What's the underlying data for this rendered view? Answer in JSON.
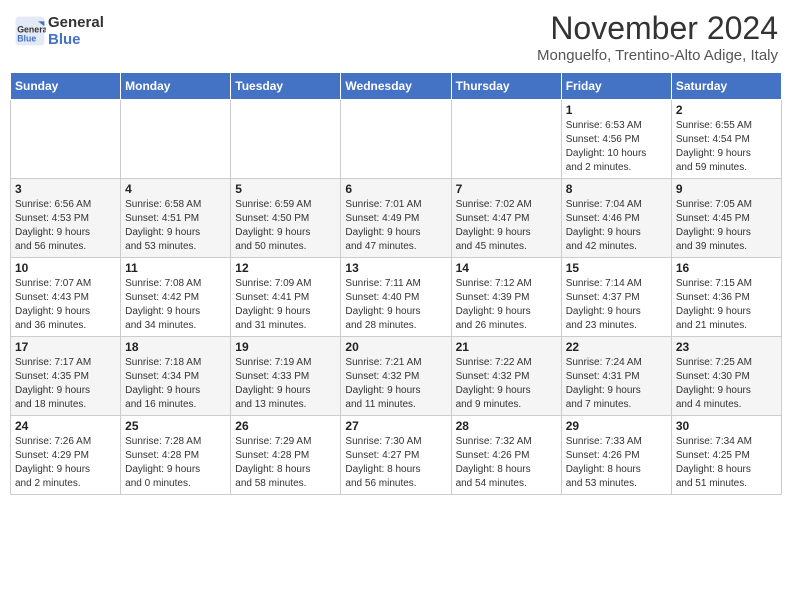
{
  "header": {
    "logo_line1": "General",
    "logo_line2": "Blue",
    "month_title": "November 2024",
    "location": "Monguelfo, Trentino-Alto Adige, Italy"
  },
  "weekdays": [
    "Sunday",
    "Monday",
    "Tuesday",
    "Wednesday",
    "Thursday",
    "Friday",
    "Saturday"
  ],
  "weeks": [
    [
      {
        "day": "",
        "detail": ""
      },
      {
        "day": "",
        "detail": ""
      },
      {
        "day": "",
        "detail": ""
      },
      {
        "day": "",
        "detail": ""
      },
      {
        "day": "",
        "detail": ""
      },
      {
        "day": "1",
        "detail": "Sunrise: 6:53 AM\nSunset: 4:56 PM\nDaylight: 10 hours\nand 2 minutes."
      },
      {
        "day": "2",
        "detail": "Sunrise: 6:55 AM\nSunset: 4:54 PM\nDaylight: 9 hours\nand 59 minutes."
      }
    ],
    [
      {
        "day": "3",
        "detail": "Sunrise: 6:56 AM\nSunset: 4:53 PM\nDaylight: 9 hours\nand 56 minutes."
      },
      {
        "day": "4",
        "detail": "Sunrise: 6:58 AM\nSunset: 4:51 PM\nDaylight: 9 hours\nand 53 minutes."
      },
      {
        "day": "5",
        "detail": "Sunrise: 6:59 AM\nSunset: 4:50 PM\nDaylight: 9 hours\nand 50 minutes."
      },
      {
        "day": "6",
        "detail": "Sunrise: 7:01 AM\nSunset: 4:49 PM\nDaylight: 9 hours\nand 47 minutes."
      },
      {
        "day": "7",
        "detail": "Sunrise: 7:02 AM\nSunset: 4:47 PM\nDaylight: 9 hours\nand 45 minutes."
      },
      {
        "day": "8",
        "detail": "Sunrise: 7:04 AM\nSunset: 4:46 PM\nDaylight: 9 hours\nand 42 minutes."
      },
      {
        "day": "9",
        "detail": "Sunrise: 7:05 AM\nSunset: 4:45 PM\nDaylight: 9 hours\nand 39 minutes."
      }
    ],
    [
      {
        "day": "10",
        "detail": "Sunrise: 7:07 AM\nSunset: 4:43 PM\nDaylight: 9 hours\nand 36 minutes."
      },
      {
        "day": "11",
        "detail": "Sunrise: 7:08 AM\nSunset: 4:42 PM\nDaylight: 9 hours\nand 34 minutes."
      },
      {
        "day": "12",
        "detail": "Sunrise: 7:09 AM\nSunset: 4:41 PM\nDaylight: 9 hours\nand 31 minutes."
      },
      {
        "day": "13",
        "detail": "Sunrise: 7:11 AM\nSunset: 4:40 PM\nDaylight: 9 hours\nand 28 minutes."
      },
      {
        "day": "14",
        "detail": "Sunrise: 7:12 AM\nSunset: 4:39 PM\nDaylight: 9 hours\nand 26 minutes."
      },
      {
        "day": "15",
        "detail": "Sunrise: 7:14 AM\nSunset: 4:37 PM\nDaylight: 9 hours\nand 23 minutes."
      },
      {
        "day": "16",
        "detail": "Sunrise: 7:15 AM\nSunset: 4:36 PM\nDaylight: 9 hours\nand 21 minutes."
      }
    ],
    [
      {
        "day": "17",
        "detail": "Sunrise: 7:17 AM\nSunset: 4:35 PM\nDaylight: 9 hours\nand 18 minutes."
      },
      {
        "day": "18",
        "detail": "Sunrise: 7:18 AM\nSunset: 4:34 PM\nDaylight: 9 hours\nand 16 minutes."
      },
      {
        "day": "19",
        "detail": "Sunrise: 7:19 AM\nSunset: 4:33 PM\nDaylight: 9 hours\nand 13 minutes."
      },
      {
        "day": "20",
        "detail": "Sunrise: 7:21 AM\nSunset: 4:32 PM\nDaylight: 9 hours\nand 11 minutes."
      },
      {
        "day": "21",
        "detail": "Sunrise: 7:22 AM\nSunset: 4:32 PM\nDaylight: 9 hours\nand 9 minutes."
      },
      {
        "day": "22",
        "detail": "Sunrise: 7:24 AM\nSunset: 4:31 PM\nDaylight: 9 hours\nand 7 minutes."
      },
      {
        "day": "23",
        "detail": "Sunrise: 7:25 AM\nSunset: 4:30 PM\nDaylight: 9 hours\nand 4 minutes."
      }
    ],
    [
      {
        "day": "24",
        "detail": "Sunrise: 7:26 AM\nSunset: 4:29 PM\nDaylight: 9 hours\nand 2 minutes."
      },
      {
        "day": "25",
        "detail": "Sunrise: 7:28 AM\nSunset: 4:28 PM\nDaylight: 9 hours\nand 0 minutes."
      },
      {
        "day": "26",
        "detail": "Sunrise: 7:29 AM\nSunset: 4:28 PM\nDaylight: 8 hours\nand 58 minutes."
      },
      {
        "day": "27",
        "detail": "Sunrise: 7:30 AM\nSunset: 4:27 PM\nDaylight: 8 hours\nand 56 minutes."
      },
      {
        "day": "28",
        "detail": "Sunrise: 7:32 AM\nSunset: 4:26 PM\nDaylight: 8 hours\nand 54 minutes."
      },
      {
        "day": "29",
        "detail": "Sunrise: 7:33 AM\nSunset: 4:26 PM\nDaylight: 8 hours\nand 53 minutes."
      },
      {
        "day": "30",
        "detail": "Sunrise: 7:34 AM\nSunset: 4:25 PM\nDaylight: 8 hours\nand 51 minutes."
      }
    ]
  ]
}
